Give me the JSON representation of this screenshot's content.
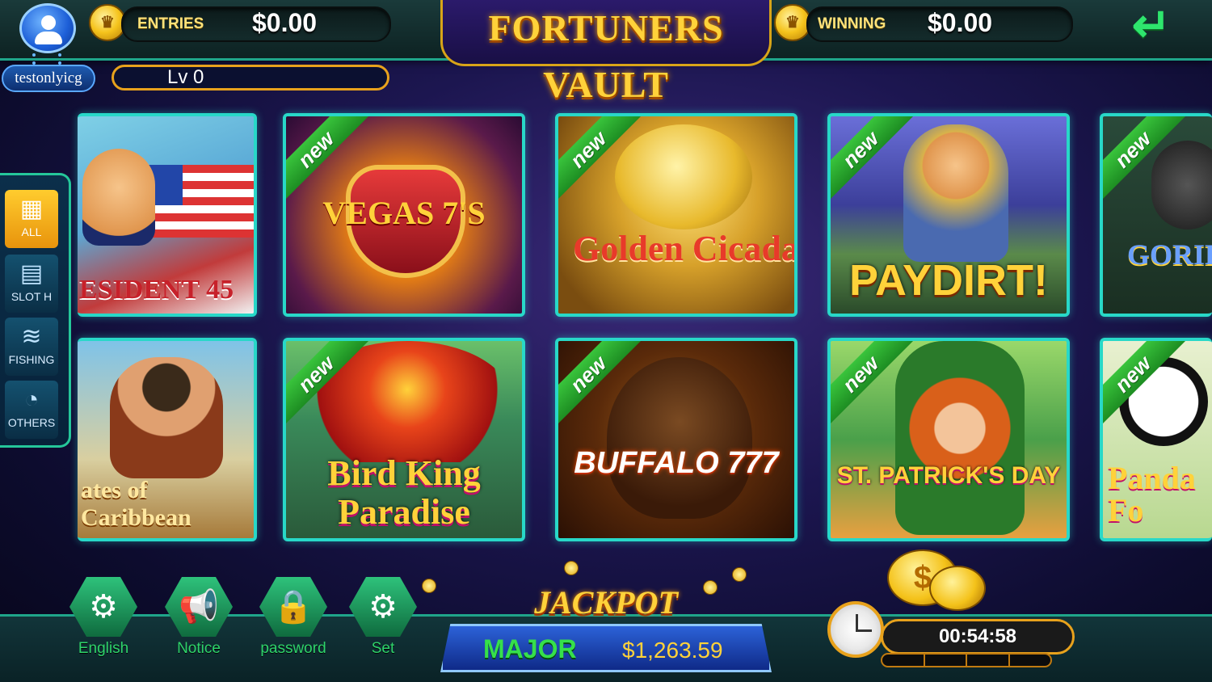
{
  "header": {
    "username": "testonlyicg",
    "level": "Lv 0",
    "entries_label": "ENTRIES",
    "entries_value": "$0.00",
    "winning_label": "WINNING",
    "winning_value": "$0.00",
    "logo": "FORTUNERS VAULT"
  },
  "categories": [
    {
      "label": "ALL",
      "icon": "grid-icon",
      "active": true
    },
    {
      "label": "SLOT H",
      "icon": "slot-machine-icon",
      "active": false
    },
    {
      "label": "FISHING",
      "icon": "shark-icon",
      "active": false
    },
    {
      "label": "OTHERS",
      "icon": "pie-chart-icon",
      "active": false
    }
  ],
  "games": [
    {
      "title": "ESIDENT 45",
      "new": false
    },
    {
      "title": "VEGAS 7'S",
      "new": true
    },
    {
      "title": "Golden Cicada",
      "new": true
    },
    {
      "title": "PAYDIRT!",
      "new": true
    },
    {
      "title": "GORILL",
      "new": true
    },
    {
      "title": "ates of Caribbean",
      "new": false
    },
    {
      "title": "Bird King Paradise",
      "new": true
    },
    {
      "title": "BUFFALO 777",
      "new": true
    },
    {
      "title": "ST. PATRICK'S DAY",
      "new": true
    },
    {
      "title": "Panda Fo",
      "new": true
    }
  ],
  "new_ribbon": "new",
  "footer": {
    "buttons": [
      {
        "label": "English",
        "icon": "gear-icon"
      },
      {
        "label": "Notice",
        "icon": "megaphone-icon"
      },
      {
        "label": "password",
        "icon": "lock-icon"
      },
      {
        "label": "Set",
        "icon": "gear-icon"
      }
    ],
    "jackpot_title": "JACKPOT",
    "jackpot_tier": "MAJOR",
    "jackpot_amount": "$1,263.59",
    "timer": "00:54:58",
    "coin_symbol": "$"
  },
  "colors": {
    "tile_border": "#28d8c8",
    "ribbon_green": "#39c43c",
    "gold": "#ffd23a",
    "active_category": "#ffcc2e"
  }
}
